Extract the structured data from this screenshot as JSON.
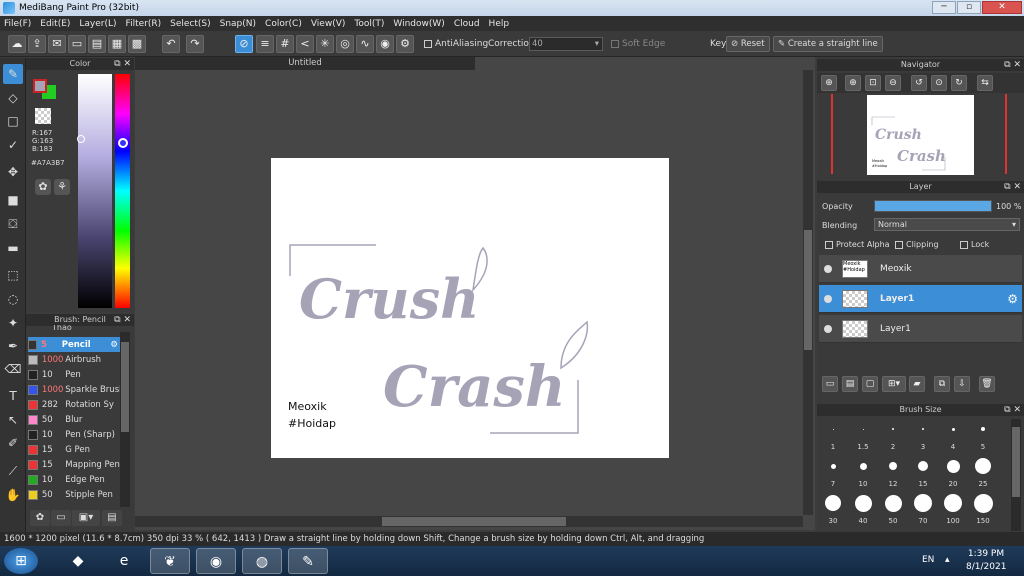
{
  "window": {
    "title": "MediBang Paint Pro (32bit)",
    "min": "─",
    "max": "▫",
    "close": "✕"
  },
  "menu": [
    "File(F)",
    "Edit(E)",
    "Layer(L)",
    "Filter(R)",
    "Select(S)",
    "Snap(N)",
    "Color(C)",
    "View(V)",
    "Tool(T)",
    "Window(W)",
    "Cloud",
    "Help"
  ],
  "toolbar": {
    "antialiasing": "AntiAliasing",
    "correction_label": "Correction",
    "correction_value": "40",
    "soft_edge": "Soft Edge",
    "key_label": "Key",
    "reset": "Reset",
    "straight_line": "Create a straight line"
  },
  "color_panel": {
    "title": "Color",
    "rgb_r": "R:167",
    "rgb_g": "G:163",
    "rgb_b": "B:183",
    "hex": "#A7A3B7",
    "colors": {
      "primary": "#A7A3B7",
      "secondary": "#22CC22",
      "accent": "#CC2222"
    }
  },
  "brush_panel": {
    "title": "Brush: Pencil",
    "partial": "Thao",
    "items": [
      {
        "size": "5",
        "name": "Pencil",
        "color": "#333333"
      },
      {
        "size": "1000",
        "name": "Airbrush",
        "color": "#bbbbbb"
      },
      {
        "size": "10",
        "name": "Pen",
        "color": "#222222"
      },
      {
        "size": "1000",
        "name": "Sparkle Brush",
        "color": "#3355ee"
      },
      {
        "size": "282",
        "name": "Rotation Sy",
        "color": "#ee3333"
      },
      {
        "size": "50",
        "name": "Blur",
        "color": "#ff88cc"
      },
      {
        "size": "10",
        "name": "Pen (Sharp)",
        "color": "#222222"
      },
      {
        "size": "15",
        "name": "G Pen",
        "color": "#ee3333"
      },
      {
        "size": "15",
        "name": "Mapping Pen",
        "color": "#ee3333"
      },
      {
        "size": "10",
        "name": "Edge Pen",
        "color": "#22aa22"
      },
      {
        "size": "50",
        "name": "Stipple Pen",
        "color": "#eecc22"
      }
    ]
  },
  "document": {
    "tab": "Untitled",
    "line1": "Crush",
    "line2": "Crash",
    "sig_name": "Meoxik",
    "sig_tag": "#Hoidap",
    "ink_color": "#A7A3B7"
  },
  "navigator": {
    "title": "Navigator"
  },
  "layer_panel": {
    "title": "Layer",
    "opacity_label": "Opacity",
    "opacity_value": "100 %",
    "opacity": 1.0,
    "blending_label": "Blending",
    "blending_value": "Normal",
    "protect_alpha": "Protect Alpha",
    "clipping": "Clipping",
    "lock": "Lock",
    "layers": [
      {
        "name": "Meoxik",
        "thumb": "Meoxik #Hoidap",
        "selected": false
      },
      {
        "name": "Layer1",
        "selected": true
      },
      {
        "name": "Layer1",
        "selected": false
      }
    ]
  },
  "brush_size": {
    "title": "Brush Size",
    "sizes": [
      [
        "1",
        "1.5",
        "2",
        "3",
        "4",
        "5"
      ],
      [
        "7",
        "10",
        "12",
        "15",
        "20",
        "25"
      ],
      [
        "30",
        "40",
        "50",
        "70",
        "100",
        "150"
      ]
    ]
  },
  "status": {
    "text": "1600 * 1200 pixel   (11.6 * 8.7cm)   350 dpi   33 %   ( 642, 1413 )   Draw a straight line by holding down Shift, Change a brush size by holding down Ctrl, Alt, and dragging"
  },
  "taskbar": {
    "lang": "EN",
    "time": "1:39 PM",
    "date": "8/1/2021"
  }
}
